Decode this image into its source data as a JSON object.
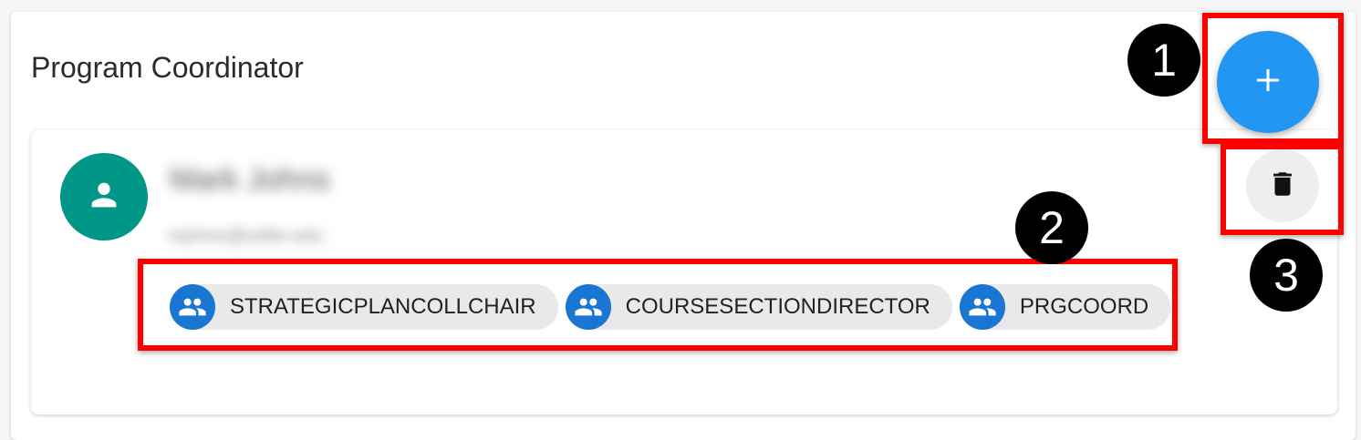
{
  "section": {
    "title": "Program Coordinator"
  },
  "user": {
    "name": "Mark Johns",
    "email": "mjohns@seller.edu",
    "avatar_icon": "person-icon",
    "avatar_color": "#009688"
  },
  "roles": [
    {
      "label": "STRATEGICPLANCOLLCHAIR",
      "icon": "group-icon"
    },
    {
      "label": "COURSESECTIONDIRECTOR",
      "icon": "group-icon"
    },
    {
      "label": "PRGCOORD",
      "icon": "group-icon"
    }
  ],
  "actions": {
    "add_icon": "plus-icon",
    "delete_icon": "trash-icon"
  },
  "annotations": {
    "marker_1": "1",
    "marker_2": "2",
    "marker_3": "3"
  },
  "colors": {
    "fab": "#2196f3",
    "chip_icon": "#1976d2",
    "highlight": "#ff0000"
  }
}
